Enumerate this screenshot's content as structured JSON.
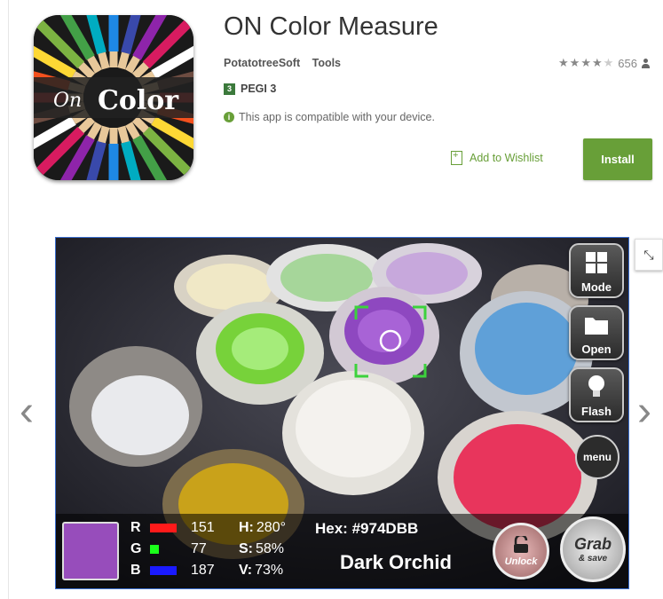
{
  "app": {
    "title": "ON Color Measure",
    "developer": "PotatotreeSoft",
    "category": "Tools",
    "rating_stars": 4,
    "rating_count": "656",
    "content_rating": "PEGI 3",
    "compatibility": "This app is compatible with your device.",
    "wishlist_label": "Add to Wishlist",
    "install_label": "Install",
    "icon_text": {
      "script": "On",
      "word": "Color"
    }
  },
  "colors": {
    "accent": "#689f38",
    "gallery_border": "#3b6fd0"
  },
  "gallery": {
    "prev_icon": "chevron-left-icon",
    "next_icon": "chevron-right-icon",
    "collapse_icon": "collapse-arrows-icon",
    "screenshot": {
      "buttons": {
        "mode": "Mode",
        "open": "Open",
        "flash": "Flash",
        "menu": "menu",
        "unlock": "Unlock",
        "grab": "Grab",
        "grab_sub": "& save"
      },
      "reading": {
        "r_label": "R",
        "r_value": "151",
        "g_label": "G",
        "g_value": "77",
        "b_label": "B",
        "b_value": "187",
        "h_label": "H:",
        "h_value": "280°",
        "s_label": "S:",
        "s_value": "58%",
        "v_label": "V:",
        "v_value": "73%",
        "hex_label": "Hex:",
        "hex_value": "#974DBB",
        "color_name": "Dark Orchid",
        "swatch_color": "#974DBB"
      }
    }
  }
}
